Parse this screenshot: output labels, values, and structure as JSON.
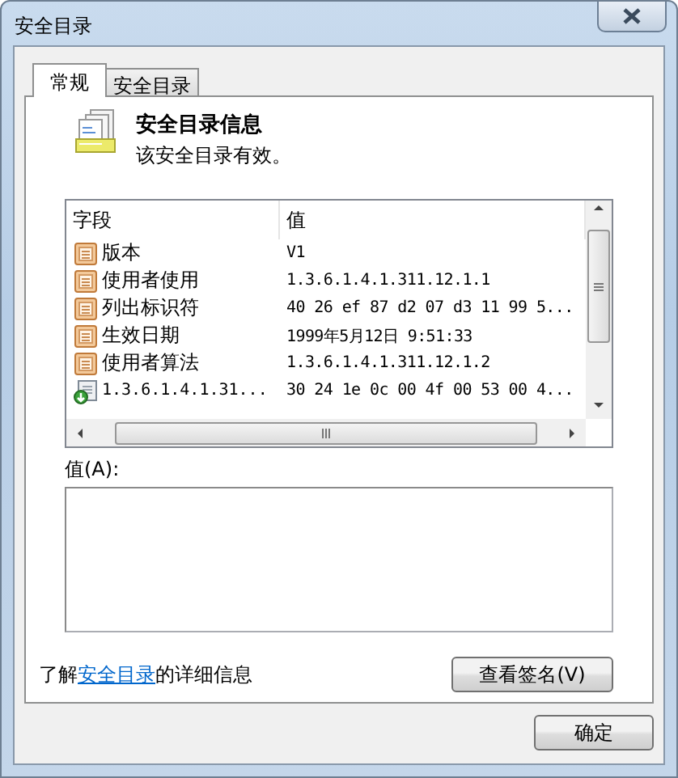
{
  "window": {
    "title": "安全目录"
  },
  "tabs": [
    {
      "label": "常规",
      "selected": true
    },
    {
      "label": "安全目录",
      "selected": false
    }
  ],
  "header": {
    "title": "安全目录信息",
    "subtitle": "该安全目录有效。"
  },
  "table": {
    "columns": [
      "字段",
      "值"
    ],
    "rows": [
      {
        "kind": "field",
        "field": "版本",
        "value": "V1"
      },
      {
        "kind": "field",
        "field": "使用者使用",
        "value": "1.3.6.1.4.1.311.12.1.1"
      },
      {
        "kind": "field",
        "field": "列出标识符",
        "value": "40 26 ef 87 d2 07 d3 11 99 5..."
      },
      {
        "kind": "field",
        "field": "生效日期",
        "value": "1999年5月12日 9:51:33"
      },
      {
        "kind": "field",
        "field": "使用者算法",
        "value": "1.3.6.1.4.1.311.12.1.2"
      },
      {
        "kind": "extension",
        "field": "1.3.6.1.4.1.31...",
        "value": "30 24 1e 0c 00 4f 00 53 00 4..."
      }
    ]
  },
  "value_label": "值(A):",
  "info": {
    "before": "了解",
    "link": "安全目录",
    "after": "的详细信息"
  },
  "view_signature_button": "查看签名(V)",
  "ok_button": "确定"
}
